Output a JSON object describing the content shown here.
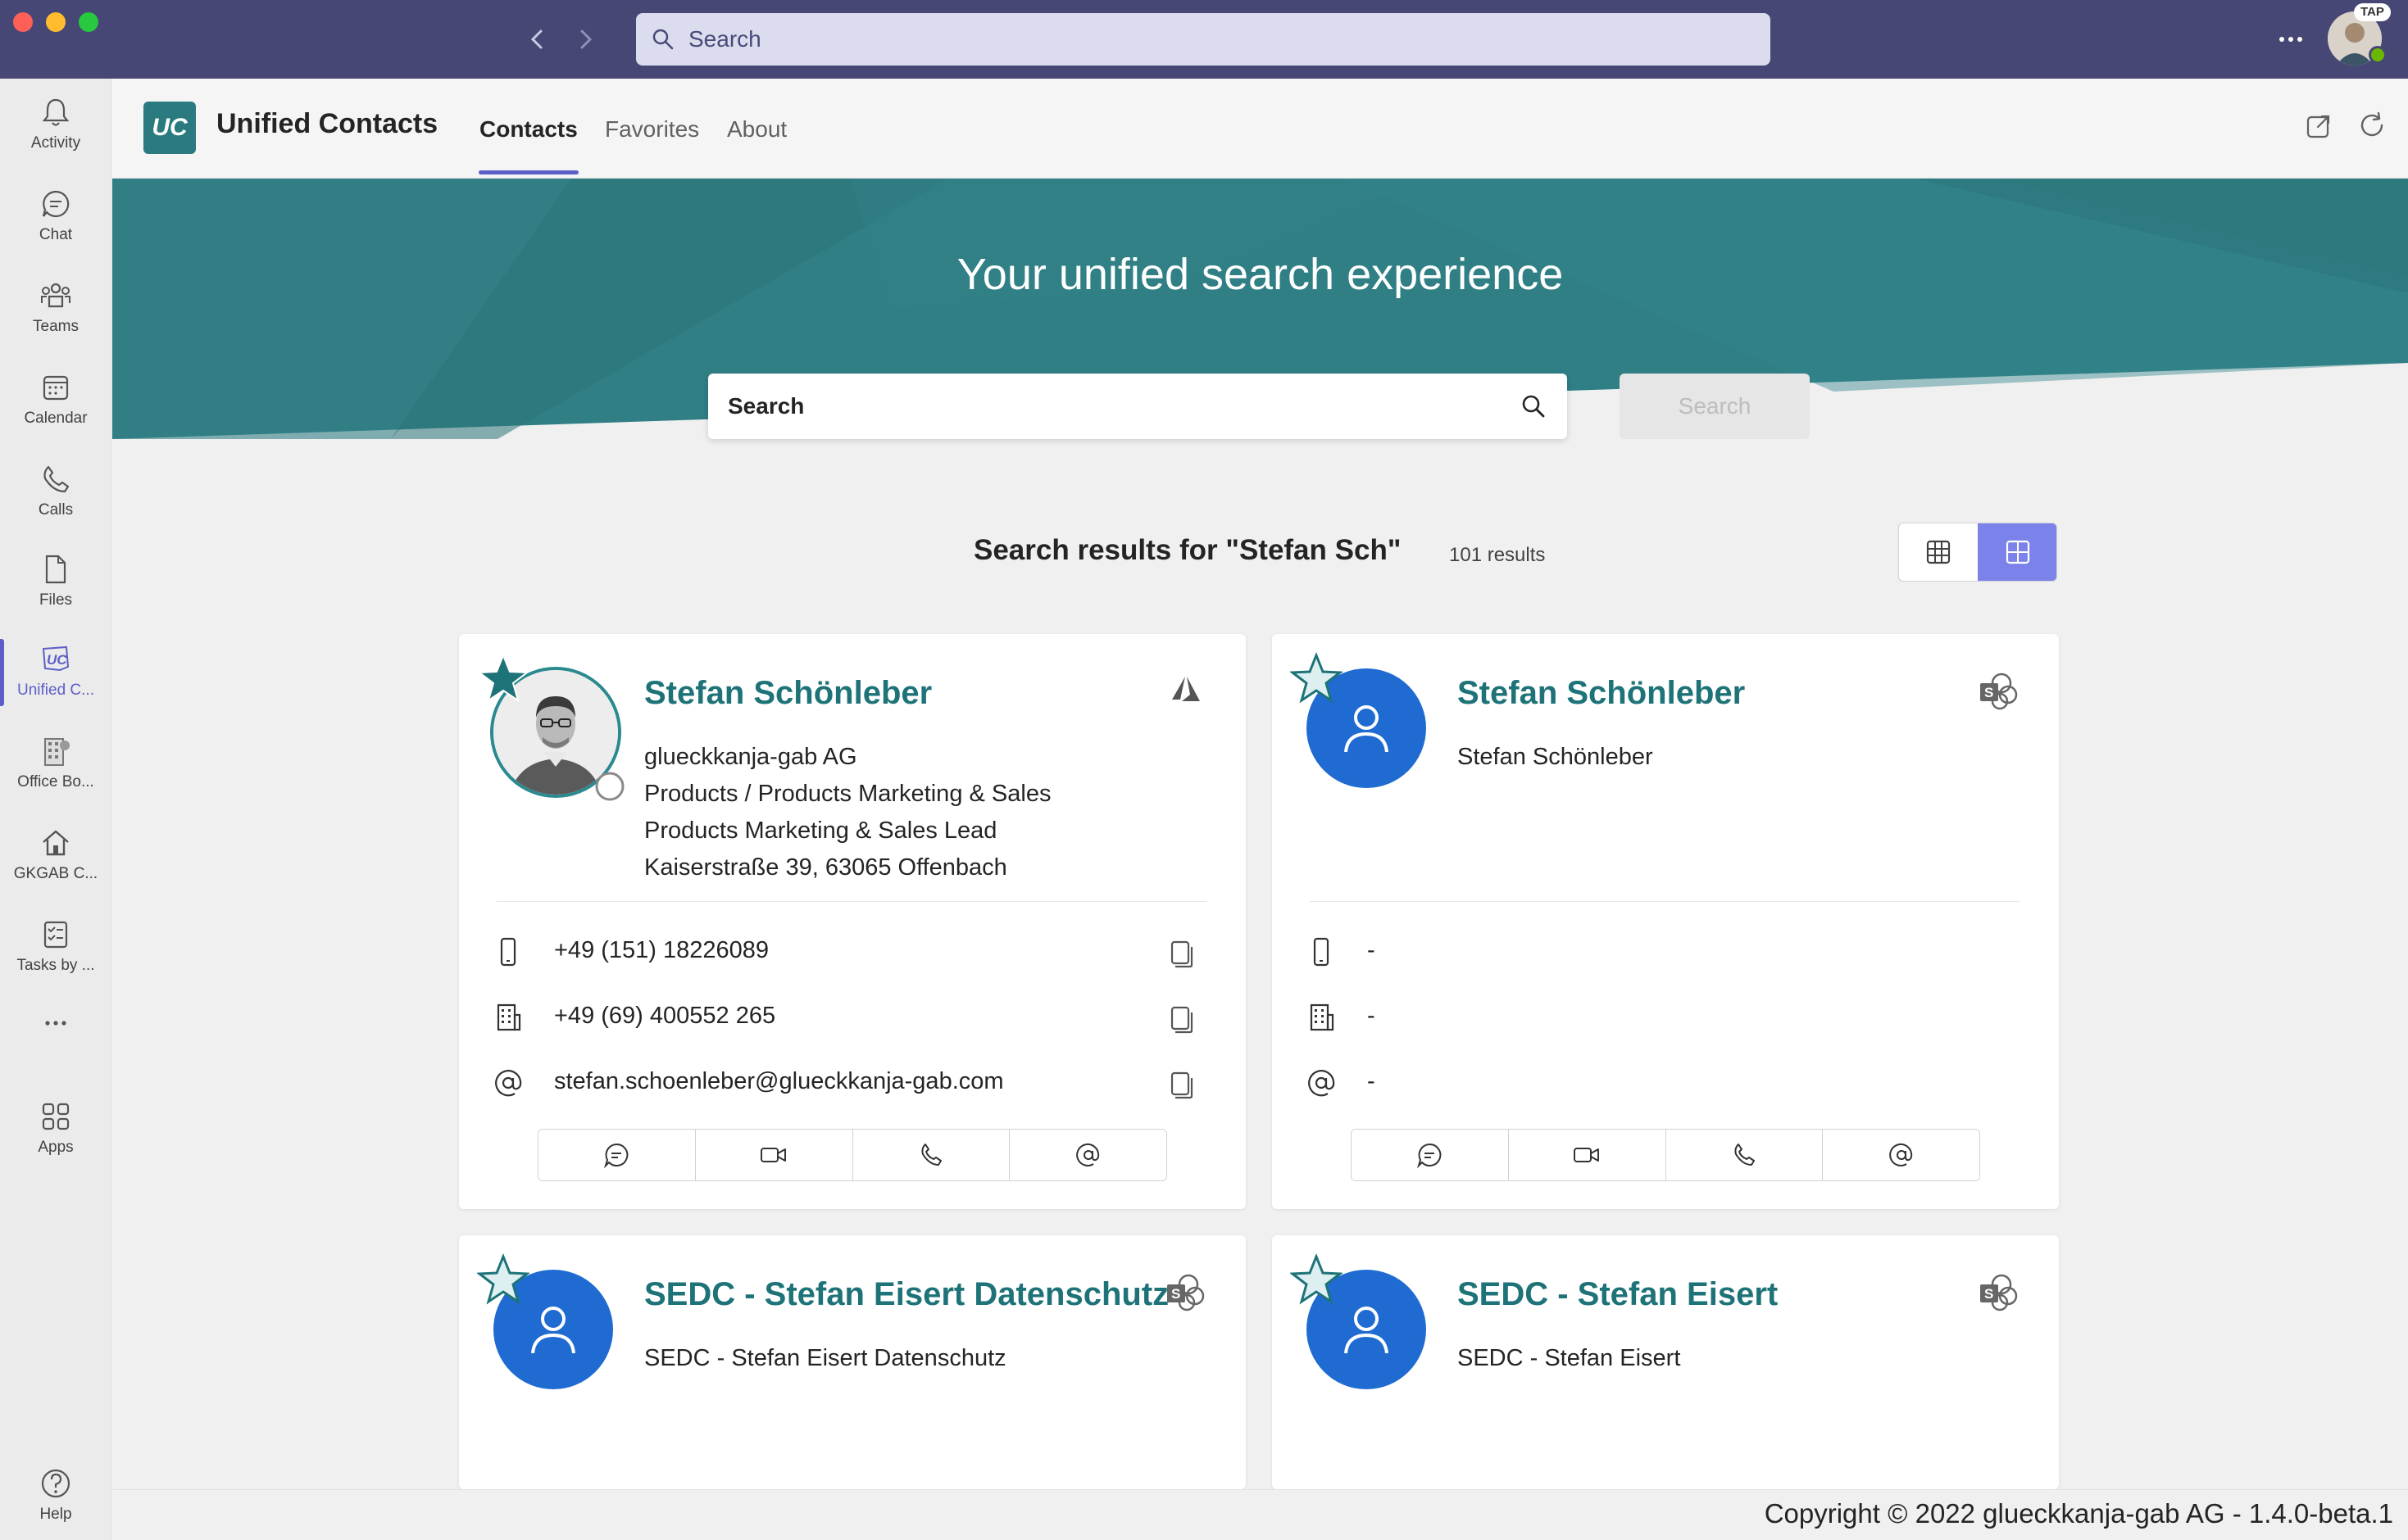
{
  "titlebar": {
    "search_placeholder": "Search",
    "badge": "TAP",
    "icons": [
      "chevron-left-icon",
      "chevron-right-icon",
      "search-icon",
      "more-icon"
    ]
  },
  "rail": {
    "items": [
      {
        "label": "Activity",
        "icon": "bell-icon"
      },
      {
        "label": "Chat",
        "icon": "chat-icon"
      },
      {
        "label": "Teams",
        "icon": "teams-icon"
      },
      {
        "label": "Calendar",
        "icon": "calendar-icon"
      },
      {
        "label": "Calls",
        "icon": "phone-icon"
      },
      {
        "label": "Files",
        "icon": "file-icon"
      },
      {
        "label": "Unified C...",
        "icon": "unified-contacts-icon",
        "active": true
      },
      {
        "label": "Office Bo...",
        "icon": "office-building-icon"
      },
      {
        "label": "GKGAB C...",
        "icon": "home-icon"
      },
      {
        "label": "Tasks by ...",
        "icon": "tasks-icon"
      },
      {
        "label": "",
        "icon": "more-icon"
      },
      {
        "label": "Apps",
        "icon": "apps-icon"
      }
    ],
    "help_label": "Help"
  },
  "app": {
    "logo_text": "UC",
    "title": "Unified Contacts",
    "tabs": [
      {
        "label": "Contacts",
        "active": true
      },
      {
        "label": "Favorites"
      },
      {
        "label": "About"
      }
    ]
  },
  "hero": {
    "title": "Your unified search experience",
    "search_placeholder": "Search",
    "search_button": "Search",
    "color": "#2f7f85"
  },
  "results": {
    "heading": "Search results for \"Stefan Sch\"",
    "count": "101 results",
    "view": "grid"
  },
  "cards": [
    {
      "name": "Stefan Schönleber",
      "source_icon": "azure-ad-icon",
      "has_photo": true,
      "details": [
        "glueckkanja-gab AG",
        "Products / Products Marketing & Sales",
        "Products Marketing & Sales Lead",
        "Kaiserstraße 39, 63065 Offenbach"
      ],
      "mobile": "+49 (151) 18226089",
      "office": "+49 (69) 400552 265",
      "email": "stefan.schoenleber@glueckkanja-gab.com",
      "copyable": true
    },
    {
      "name": "Stefan Schönleber",
      "source_icon": "sharepoint-icon",
      "has_photo": false,
      "details": [
        "Stefan Schönleber"
      ],
      "mobile": "-",
      "office": "-",
      "email": "-",
      "copyable": false
    },
    {
      "name": "SEDC - Stefan Eisert Datenschutz",
      "source_icon": "sharepoint-icon",
      "has_photo": false,
      "details": [
        "SEDC - Stefan Eisert Datenschutz"
      ]
    },
    {
      "name": "SEDC - Stefan Eisert",
      "source_icon": "sharepoint-icon",
      "has_photo": false,
      "details": [
        "SEDC - Stefan Eisert"
      ]
    }
  ],
  "footer": {
    "copyright": "Copyright © 2022 glueckkanja-gab AG - 1.4.0-beta.1"
  },
  "colors": {
    "brand": "#464775",
    "accent": "#5b5fc7",
    "teal": "#1e7378",
    "avatar_blue": "#1f6bd1"
  }
}
